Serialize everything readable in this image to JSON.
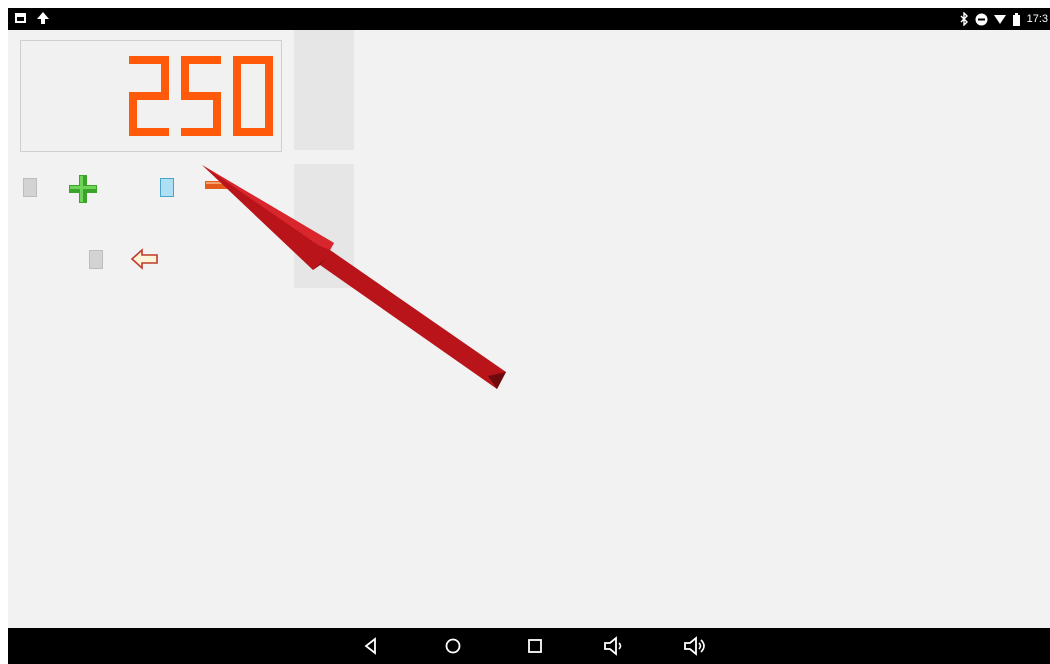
{
  "status_bar": {
    "time": "17:3",
    "left_icons": [
      "image-icon",
      "upload-icon"
    ],
    "right_icons": [
      "bluetooth-icon",
      "do-not-disturb-icon",
      "wifi-icon",
      "battery-icon"
    ]
  },
  "counter": {
    "value": "250",
    "digit_color": "#ff5a0a"
  },
  "controls": {
    "increment_icon": "plus-icon",
    "decrement_icon": "minus-icon",
    "back_icon": "back-arrow-icon"
  },
  "annotation": {
    "pointer": "red-arrow-pointer",
    "color": "#b8141a"
  },
  "nav_bar": {
    "buttons": [
      "back-nav-icon",
      "home-icon",
      "recents-icon",
      "volume-down-icon",
      "volume-up-icon"
    ]
  }
}
